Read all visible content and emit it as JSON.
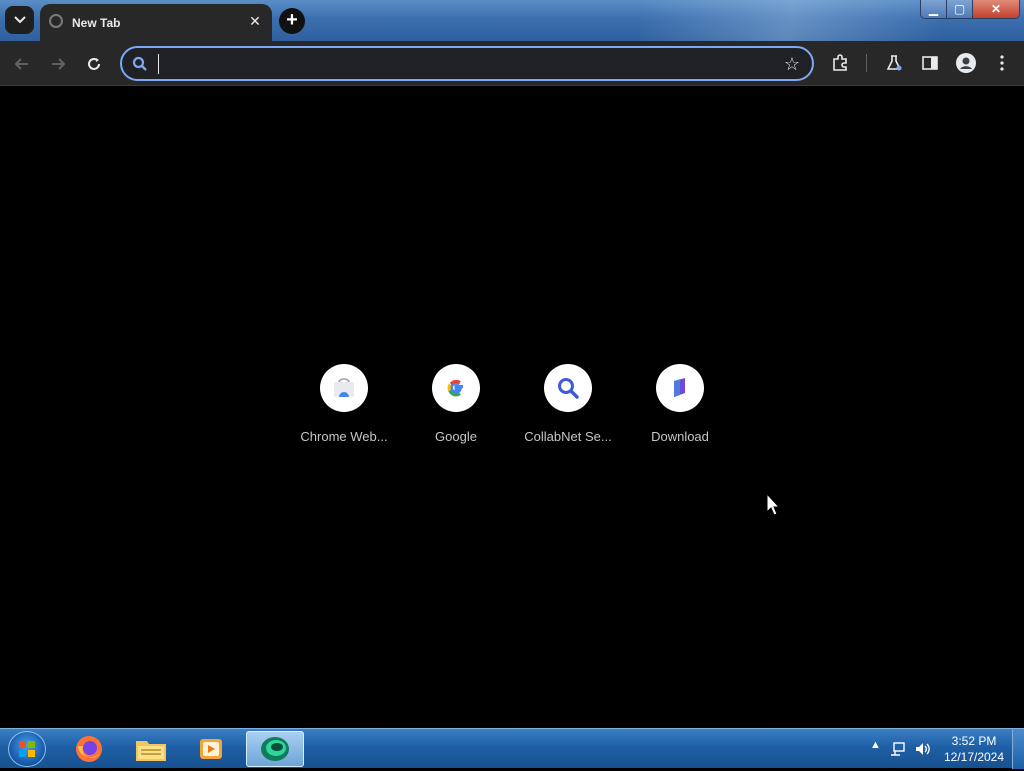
{
  "browser": {
    "tab": {
      "title": "New Tab",
      "close": "✕"
    },
    "new_tab": "+",
    "window_controls": {
      "minimize": "▁",
      "maximize": "▢",
      "close": "✕"
    },
    "toolbar": {
      "back_icon": "arrow-left-icon",
      "forward_icon": "arrow-right-icon",
      "reload_icon": "reload-icon",
      "omnibox": {
        "value": "",
        "placeholder": ""
      },
      "bookmark_icon": "star-icon",
      "extensions_icon": "puzzle-icon",
      "labs_icon": "flask-icon",
      "side_panel_icon": "side-panel-icon",
      "profile_icon": "profile-icon",
      "menu_icon": "more-vert-icon"
    }
  },
  "new_tab_page": {
    "shortcuts": [
      {
        "label": "Chrome Web...",
        "icon": "chrome-web-store-icon"
      },
      {
        "label": "Google",
        "icon": "google-icon"
      },
      {
        "label": "CollabNet Se...",
        "icon": "collabnet-search-icon"
      },
      {
        "label": "Download",
        "icon": "download-icon"
      }
    ]
  },
  "taskbar": {
    "apps": [
      "start-orb",
      "firefox-icon",
      "file-explorer-icon",
      "media-player-icon",
      "app-active-icon"
    ],
    "tray": {
      "show_hidden": "▲"
    },
    "clock": {
      "time": "3:52 PM",
      "date": "12/17/2024"
    }
  },
  "colors": {
    "accent": "#7ca8f5",
    "tab_bg": "#282828",
    "page_bg": "#000000"
  }
}
